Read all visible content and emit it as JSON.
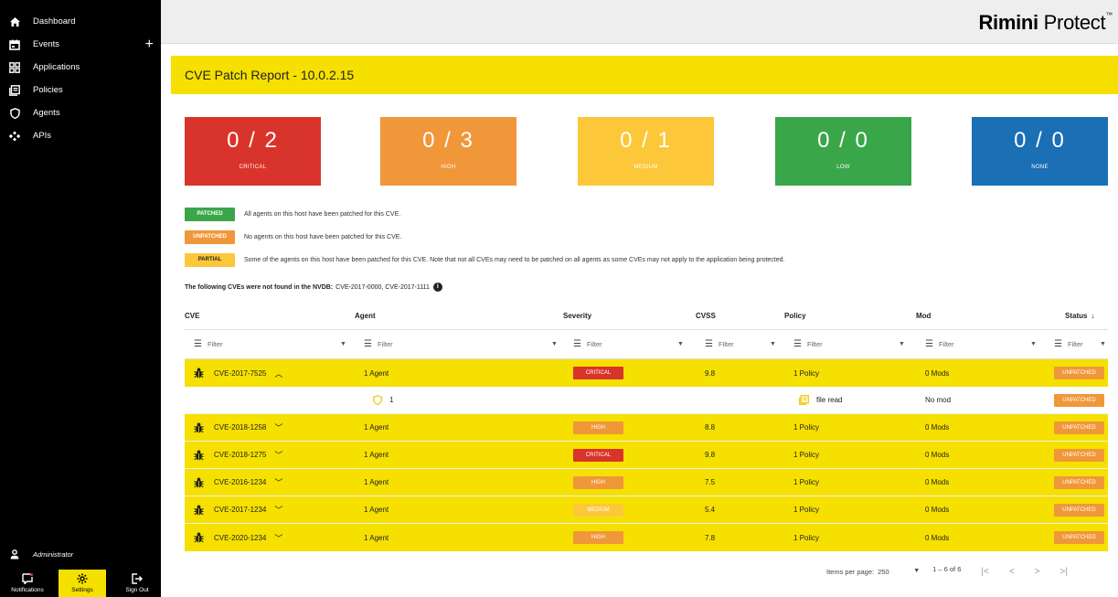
{
  "sidebar": {
    "items": [
      {
        "label": "Dashboard",
        "icon": "home-icon"
      },
      {
        "label": "Events",
        "icon": "calendar-icon",
        "plus": "+"
      },
      {
        "label": "Applications",
        "icon": "grid-icon"
      },
      {
        "label": "Policies",
        "icon": "policy-icon"
      },
      {
        "label": "Agents",
        "icon": "shield-icon"
      },
      {
        "label": "APIs",
        "icon": "api-icon"
      }
    ],
    "user": "Administrator",
    "bottom": {
      "notifications": "Notifications",
      "settings": "Settings",
      "sign_out": "Sign Out"
    }
  },
  "brand": {
    "bold": "Rimini",
    "light": " Protect",
    "tm": "™"
  },
  "page_title": "CVE Patch Report - 10.0.2.15",
  "severity_cards": [
    {
      "count": "0 / 2",
      "label": "CRITICAL",
      "color": "#d9342b"
    },
    {
      "count": "0 / 3",
      "label": "HIGH",
      "color": "#f0973a"
    },
    {
      "count": "0 / 1",
      "label": "MEDIUM",
      "color": "#fcc83a"
    },
    {
      "count": "0 / 0",
      "label": "LOW",
      "color": "#3aa64a"
    },
    {
      "count": "0 / 0",
      "label": "NONE",
      "color": "#1a6fb5"
    }
  ],
  "legend": [
    {
      "badge": "PATCHED",
      "text": "All agents on this host have been patched for this CVE."
    },
    {
      "badge": "UNPATCHED",
      "text": "No agents on this host have been patched for this CVE."
    },
    {
      "badge": "PARTIAL",
      "text": "Some of the agents on this host have been patched for this CVE. Note that not all CVEs may need to be patched on all agents as some CVEs may not apply to the application being protected."
    }
  ],
  "nvd_note": {
    "label": "The following CVEs were not found in the NVDB:",
    "value": "CVE-2017-0000, CVE-2017-1111"
  },
  "table": {
    "headers": {
      "cve": "CVE",
      "agent": "Agent",
      "severity": "Severity",
      "cvss": "CVSS",
      "policy": "Policy",
      "mod": "Mod",
      "status": "Status"
    },
    "sort_indicator": "↓",
    "filter_placeholder": "Filter",
    "rows": [
      {
        "cve": "CVE-2017-7525",
        "agent": "1 Agent",
        "severity": "CRITICAL",
        "cvss": "9.8",
        "policy": "1 Policy",
        "mod": "0 Mods",
        "status": "UNPATCHED",
        "expanded": true
      },
      {
        "cve": "CVE-2018-1258",
        "agent": "1 Agent",
        "severity": "HIGH",
        "cvss": "8.8",
        "policy": "1 Policy",
        "mod": "0 Mods",
        "status": "UNPATCHED",
        "expanded": false
      },
      {
        "cve": "CVE-2018-1275",
        "agent": "1 Agent",
        "severity": "CRITICAL",
        "cvss": "9.8",
        "policy": "1 Policy",
        "mod": "0 Mods",
        "status": "UNPATCHED",
        "expanded": false
      },
      {
        "cve": "CVE-2016-1234",
        "agent": "1 Agent",
        "severity": "HIGH",
        "cvss": "7.5",
        "policy": "1 Policy",
        "mod": "0 Mods",
        "status": "UNPATCHED",
        "expanded": false
      },
      {
        "cve": "CVE-2017-1234",
        "agent": "1 Agent",
        "severity": "MEDIUM",
        "cvss": "5.4",
        "policy": "1 Policy",
        "mod": "0 Mods",
        "status": "UNPATCHED",
        "expanded": false
      },
      {
        "cve": "CVE-2020-1234",
        "agent": "1 Agent",
        "severity": "HIGH",
        "cvss": "7.8",
        "policy": "1 Policy",
        "mod": "0 Mods",
        "status": "UNPATCHED",
        "expanded": false
      }
    ],
    "detail": {
      "agent": "1",
      "policy": "file read",
      "mod": "No mod",
      "status": "UNPATCHED"
    }
  },
  "paging": {
    "items_per_page_label": "Items per page:",
    "items_per_page": "250",
    "range": "1 – 6 of 6"
  }
}
